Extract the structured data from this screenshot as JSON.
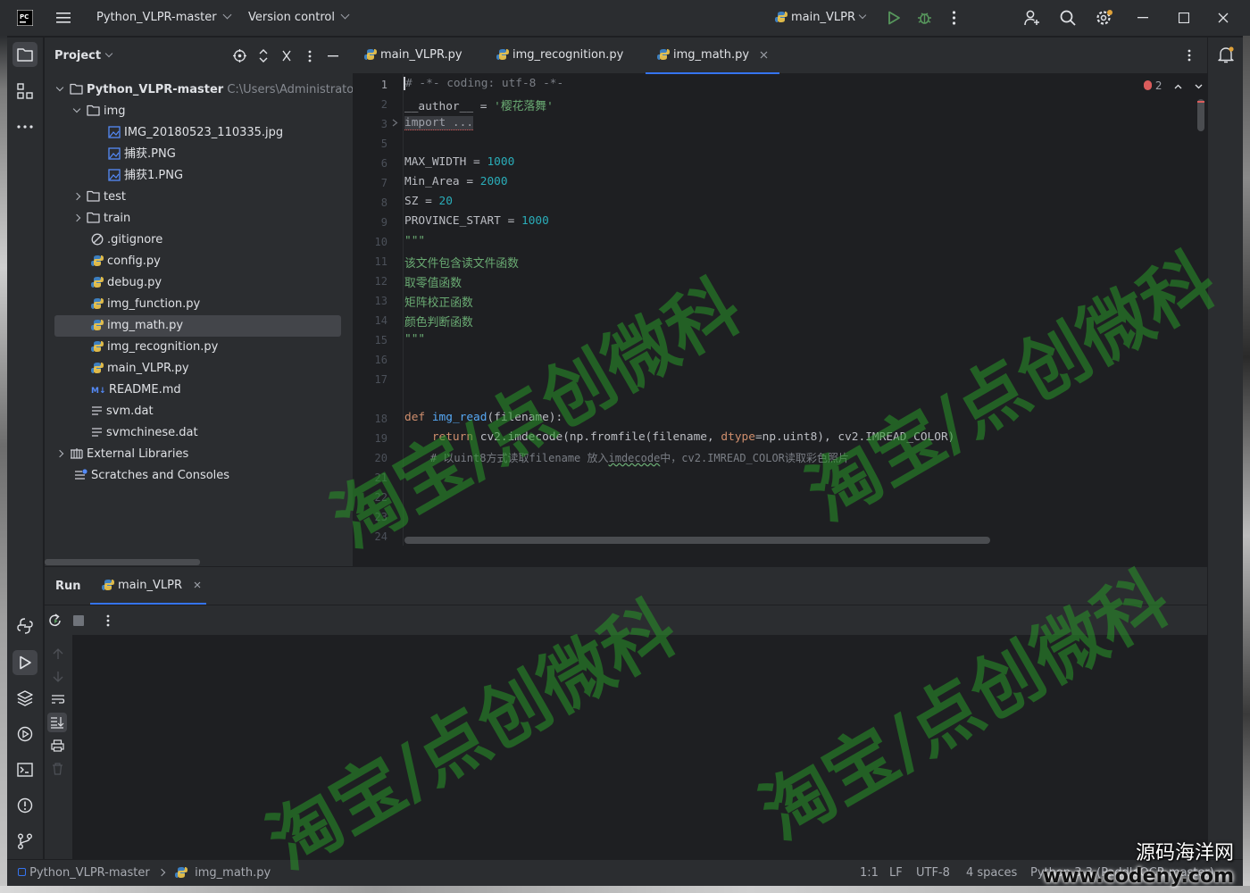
{
  "titlebar": {
    "project_name": "Python_VLPR-master",
    "vcs_label": "Version control",
    "run_config": "main_VLPR"
  },
  "project_panel": {
    "title": "Project",
    "tree": [
      {
        "label": "Python_VLPR-master",
        "path": "C:\\Users\\Administrator\\D",
        "icon": "folder-icon",
        "arrow": "down"
      },
      {
        "label": "img",
        "icon": "folder-icon",
        "arrow": "down"
      },
      {
        "label": "IMG_20180523_110335.jpg",
        "icon": "image-file-icon"
      },
      {
        "label": "捕获.PNG",
        "icon": "image-file-icon"
      },
      {
        "label": "捕获1.PNG",
        "icon": "image-file-icon"
      },
      {
        "label": "test",
        "icon": "folder-icon",
        "arrow": "right"
      },
      {
        "label": "train",
        "icon": "folder-icon",
        "arrow": "right"
      },
      {
        "label": ".gitignore",
        "icon": "ignore-file-icon"
      },
      {
        "label": "config.py",
        "icon": "python-file-icon"
      },
      {
        "label": "debug.py",
        "icon": "python-file-icon"
      },
      {
        "label": "img_function.py",
        "icon": "python-file-icon"
      },
      {
        "label": "img_math.py",
        "icon": "python-file-icon",
        "selected": true
      },
      {
        "label": "img_recognition.py",
        "icon": "python-file-icon"
      },
      {
        "label": "main_VLPR.py",
        "icon": "python-file-icon"
      },
      {
        "label": "README.md",
        "icon": "markdown-file-icon"
      },
      {
        "label": "svm.dat",
        "icon": "text-file-icon"
      },
      {
        "label": "svmchinese.dat",
        "icon": "text-file-icon"
      },
      {
        "label": "External Libraries",
        "icon": "library-icon",
        "arrow": "right"
      },
      {
        "label": "Scratches and Consoles",
        "icon": "scratches-icon"
      }
    ]
  },
  "editor": {
    "tabs": [
      {
        "label": "main_VLPR.py"
      },
      {
        "label": "img_recognition.py"
      },
      {
        "label": "img_math.py",
        "active": true
      }
    ],
    "error_count": "2",
    "line_numbers": [
      "1",
      "2",
      "3",
      "5",
      "6",
      "7",
      "8",
      "9",
      "10",
      "11",
      "12",
      "13",
      "14",
      "15",
      "16",
      "17",
      "18",
      "19",
      "20",
      "21",
      "22",
      "23",
      "24"
    ],
    "code": {
      "l1": "# -*- coding: utf-8 -*-",
      "l2_name": "__author__",
      "l2_eq": " = ",
      "l2_str": "'樱花落舞'",
      "l3": "import ...",
      "l6_name": "MAX_WIDTH = ",
      "l6_val": "1000",
      "l7_name": "Min_Area = ",
      "l7_val": "2000",
      "l8_name": "SZ = ",
      "l8_val": "20",
      "l9_name": "PROVINCE_START = ",
      "l9_val": "1000",
      "l10": "\"\"\"",
      "l11": "该文件包含读文件函数",
      "l12": "取零值函数",
      "l13": "矩阵校正函数",
      "l14": "颜色判断函数",
      "l15": "\"\"\"",
      "l18_def": "def ",
      "l18_fn": "img_read",
      "l18_rest": "(filename):",
      "l19_ret": "    return ",
      "l19_a": "cv2.imdecode(np.fromfile(filename, ",
      "l19_param": "dtype",
      "l19_b": "=np.uint8), cv2.IMREAD_COLOR)",
      "l20_a": "    # 以uint8方式读取filename 放入",
      "l20_b": "imdecode",
      "l20_c": "中，cv2.IMREAD_COLOR读取彩色照片"
    }
  },
  "run_panel": {
    "title": "Run",
    "tab_label": "main_VLPR"
  },
  "statusbar": {
    "breadcrumb_project": "Python_VLPR-master",
    "breadcrumb_file": "img_math.py",
    "position": "1:1",
    "line_sep": "LF",
    "encoding": "UTF-8",
    "indent": "4 spaces",
    "interpreter": "Python 3.3 (PaddleOCR-master)"
  },
  "watermarks": {
    "overlay_text": "淘宝/点创微科",
    "site_name": "源码海洋网",
    "site_url": "www.codeny.com"
  },
  "colors": {
    "accent": "#3574f0",
    "run_green": "#57965c",
    "error_red": "#db5c5c",
    "watermark_green": "#289628"
  }
}
